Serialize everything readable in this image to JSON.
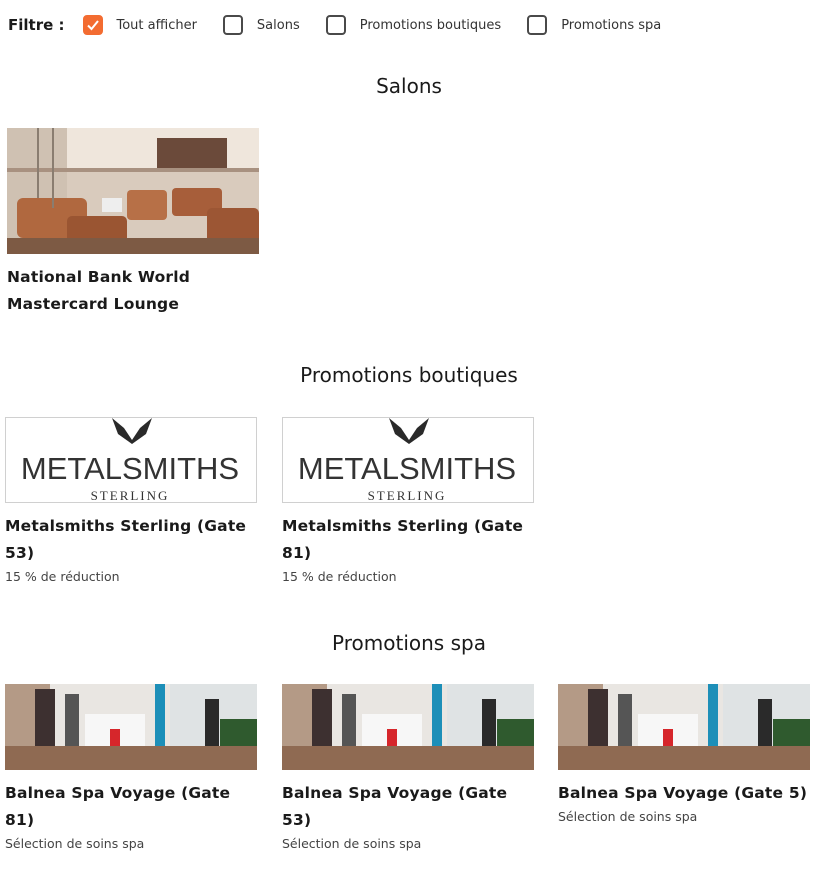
{
  "filter": {
    "label": "Filtre :",
    "options": [
      {
        "label": "Tout afficher",
        "checked": true
      },
      {
        "label": "Salons",
        "checked": false
      },
      {
        "label": "Promotions boutiques",
        "checked": false
      },
      {
        "label": "Promotions spa",
        "checked": false
      }
    ]
  },
  "accent_color": "#f36c31",
  "sections": {
    "salons": {
      "title": "Salons",
      "items": [
        {
          "title": "National Bank World Mastercard Lounge"
        }
      ]
    },
    "boutiques": {
      "title": "Promotions boutiques",
      "items": [
        {
          "title": "Metalsmiths Sterling (Gate 53)",
          "subtitle": "15 % de réduction",
          "logo_text": "METALSMITHS",
          "logo_sub": "STERLING"
        },
        {
          "title": "Metalsmiths Sterling (Gate 81)",
          "subtitle": "15 % de réduction",
          "logo_text": "METALSMITHS",
          "logo_sub": "STERLING"
        }
      ]
    },
    "spa": {
      "title": "Promotions spa",
      "items": [
        {
          "title": "Balnea Spa Voyage (Gate 81)",
          "subtitle": "Sélection de soins spa"
        },
        {
          "title": "Balnea Spa Voyage (Gate 53)",
          "subtitle": "Sélection de soins spa"
        },
        {
          "title": "Balnea Spa Voyage (Gate 5)",
          "subtitle": "Sélection de soins spa"
        }
      ]
    }
  }
}
